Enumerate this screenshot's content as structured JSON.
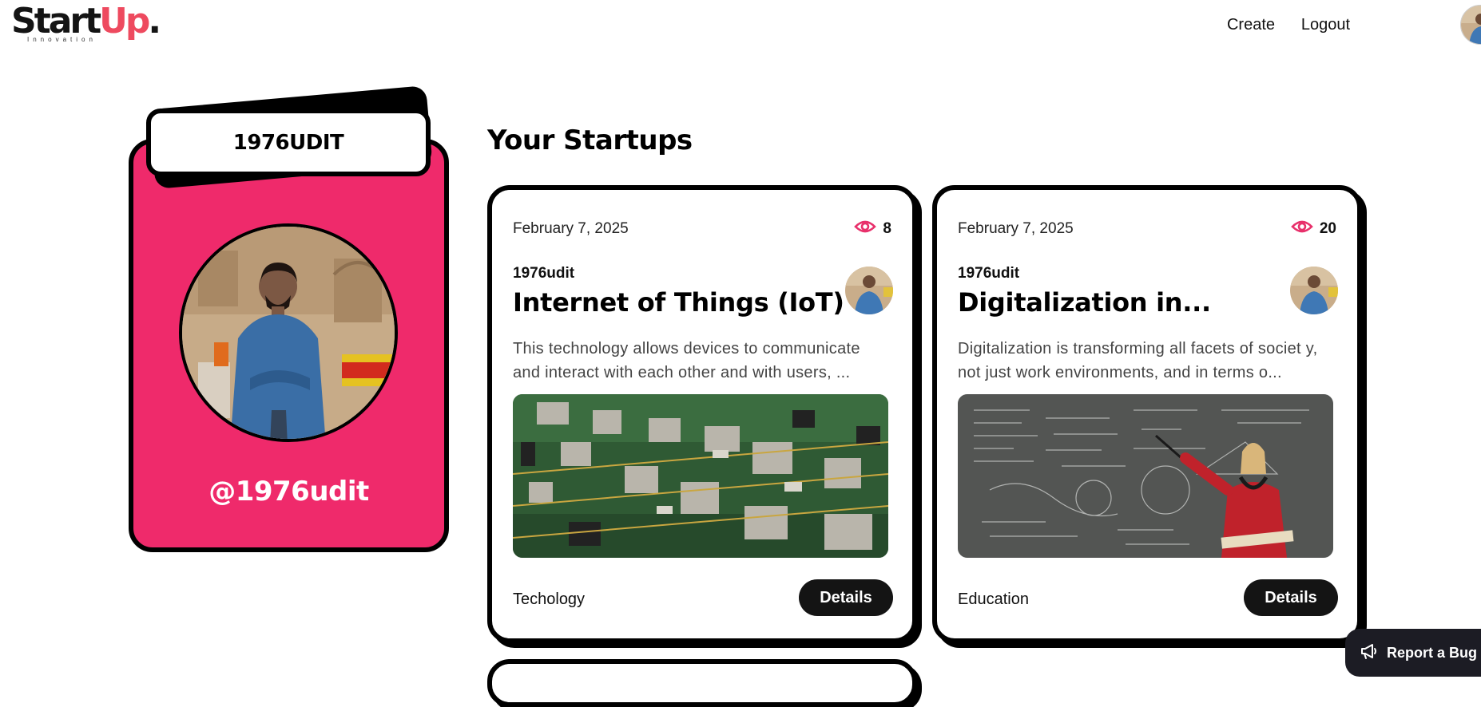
{
  "brand": {
    "part1": "Start",
    "part2": "Up",
    "dot": ".",
    "tagline": "Innovation"
  },
  "nav": {
    "create": "Create",
    "logout": "Logout"
  },
  "profile": {
    "name": "1976UDIT",
    "handle": "@1976udit"
  },
  "section_title": "Your Startups",
  "startups": [
    {
      "date": "February 7, 2025",
      "views": "8",
      "author": "1976udit",
      "title": "Internet of Things (IoT)",
      "description": "This technology allows devices to communicate and interact with each other and with users, ...",
      "category": "Techology",
      "button": "Details",
      "image": "circuit-board"
    },
    {
      "date": "February 7, 2025",
      "views": "20",
      "author": "1976udit",
      "title": "Digitalization in...",
      "description": "Digitalization is transforming all facets of societ y, not just work environments, and in terms o...",
      "category": "Education",
      "button": "Details",
      "image": "teacher-chalkboard"
    }
  ],
  "report_bug": "Report a Bug",
  "colors": {
    "accent": "#ef2a6b",
    "brand_up": "#ee4a5f",
    "button": "#141414",
    "eye_icon": "#e8306b"
  }
}
